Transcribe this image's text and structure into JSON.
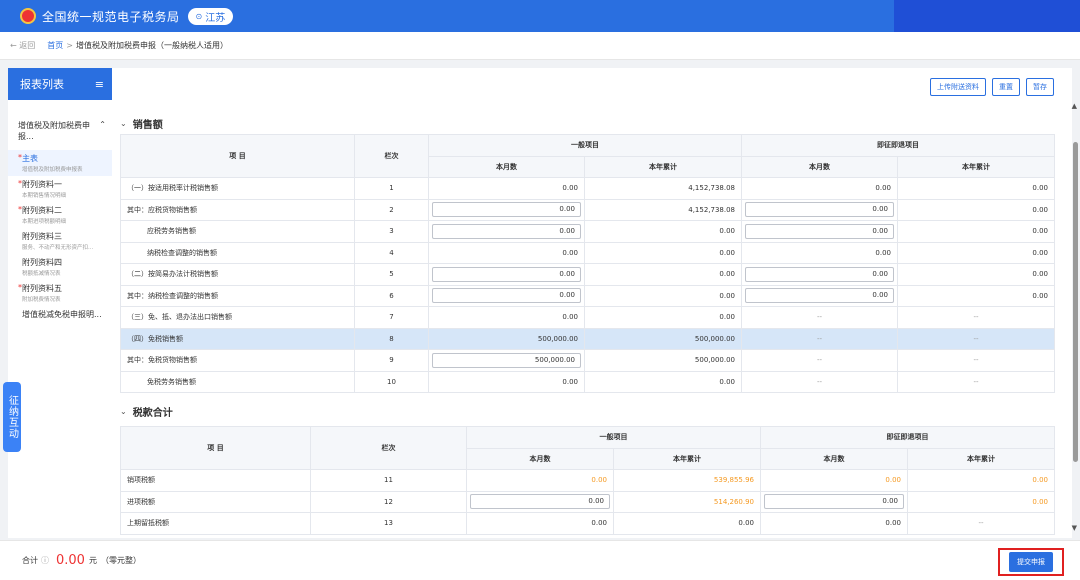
{
  "header": {
    "title": "全国统一规范电子税务局",
    "region": "江苏",
    "brand_color": "#2a6fe0"
  },
  "breadcrumb": {
    "back": "返回",
    "home": "首页",
    "current": "增值税及附加税费申报（一般纳税人适用）"
  },
  "sidebar": {
    "title": "报表列表",
    "group": "增值税及附加税费申报...",
    "items": [
      {
        "title": "主表",
        "sub": "增值税及附加税费申报表",
        "required": true,
        "active": true
      },
      {
        "title": "附列资料一",
        "sub": "本期销售情况明细",
        "required": true
      },
      {
        "title": "附列资料二",
        "sub": "本期进项税额明细",
        "required": true
      },
      {
        "title": "附列资料三",
        "sub": "服务、不动产和无形资产扣...",
        "required": false
      },
      {
        "title": "附列资料四",
        "sub": "税额抵减情况表",
        "required": false
      },
      {
        "title": "附列资料五",
        "sub": "附加税费情况表",
        "required": true
      },
      {
        "title": "增值税减免税申报明...",
        "sub": "",
        "required": false
      }
    ]
  },
  "float_tab": "征纳互动",
  "toolbar": {
    "upload": "上传附送资料",
    "reset": "重置",
    "save": "暂存"
  },
  "sales": {
    "title": "销售额",
    "headers": {
      "item": "项 目",
      "row": "栏次",
      "general": "一般项目",
      "refund": "即征即退项目",
      "month": "本月数",
      "year": "本年累计"
    },
    "rows": [
      {
        "label": "（一）按适用税率计税销售额",
        "no": "1",
        "gm": "0.00",
        "gy": "4,152,738.08",
        "rm": "0.00",
        "ry": "0.00"
      },
      {
        "label": "其中：应税货物销售额",
        "no": "2",
        "gm": "0.00",
        "gy": "4,152,738.08",
        "rm": "0.00",
        "ry": "0.00"
      },
      {
        "label": "应税劳务销售额",
        "no": "3",
        "gm": "0.00",
        "gy": "0.00",
        "rm": "0.00",
        "ry": "0.00"
      },
      {
        "label": "纳税检查调整的销售额",
        "no": "4",
        "gm": "0.00",
        "gy": "0.00",
        "rm": "0.00",
        "ry": "0.00"
      },
      {
        "label": "（二）按简易办法计税销售额",
        "no": "5",
        "gm": "0.00",
        "gy": "0.00",
        "rm": "0.00",
        "ry": "0.00"
      },
      {
        "label": "其中：纳税检查调整的销售额",
        "no": "6",
        "gm": "0.00",
        "gy": "0.00",
        "rm": "0.00",
        "ry": "0.00"
      },
      {
        "label": "（三）免、抵、退办法出口销售额",
        "no": "7",
        "gm": "0.00",
        "gy": "0.00",
        "rm": "--",
        "ry": "--"
      },
      {
        "label": "（四）免税销售额",
        "no": "8",
        "gm": "500,000.00",
        "gy": "500,000.00",
        "rm": "--",
        "ry": "--"
      },
      {
        "label": "其中：免税货物销售额",
        "no": "9",
        "gm": "500,000.00",
        "gy": "500,000.00",
        "rm": "--",
        "ry": "--"
      },
      {
        "label": "免税劳务销售额",
        "no": "10",
        "gm": "0.00",
        "gy": "0.00",
        "rm": "--",
        "ry": "--"
      }
    ]
  },
  "tax": {
    "title": "税款合计",
    "headers": {
      "item": "项 目",
      "row": "栏次",
      "general": "一般项目",
      "refund": "即征即退项目",
      "month": "本月数",
      "year": "本年累计"
    },
    "rows": [
      {
        "label": "销项税额",
        "no": "11",
        "gm": "0.00",
        "gy": "539,855.96",
        "rm": "0.00",
        "ry": "0.00"
      },
      {
        "label": "进项税额",
        "no": "12",
        "gm": "0.00",
        "gy": "514,260.90",
        "rm": "0.00",
        "ry": "0.00"
      },
      {
        "label": "上期留抵税额",
        "no": "13",
        "gm": "0.00",
        "gy": "0.00",
        "rm": "0.00",
        "ry": "--"
      }
    ]
  },
  "footer": {
    "total_label": "合计",
    "total_value": "0.00",
    "unit": "元",
    "unit_note": "（零元整）",
    "submit": "提交申报"
  }
}
